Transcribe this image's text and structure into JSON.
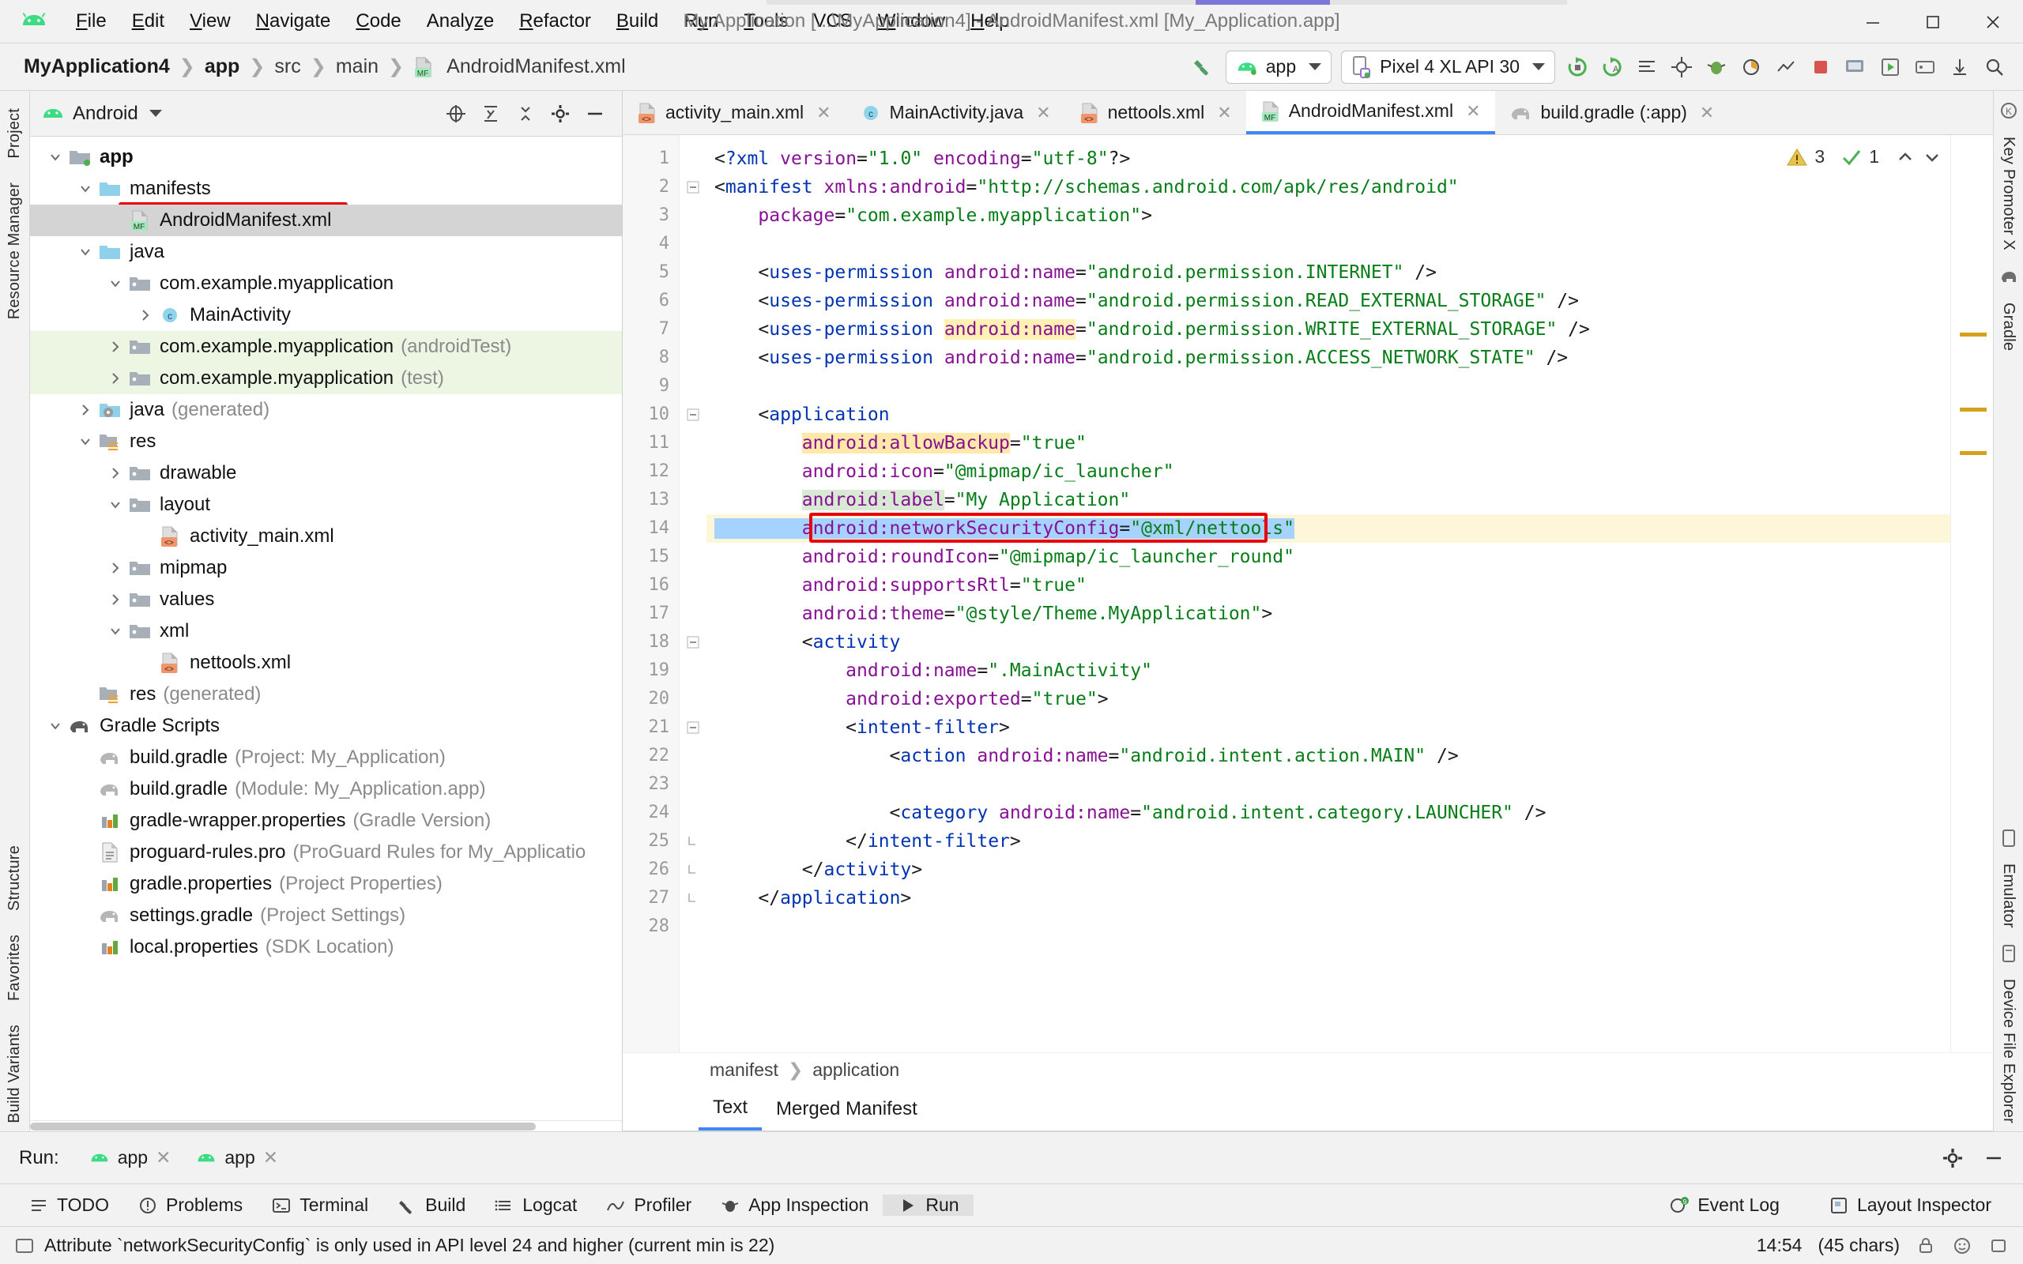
{
  "window": {
    "title": "My Application [...\\MyApplication4] - AndroidManifest.xml [My_Application.app]",
    "minimize": "—",
    "maximize": "▢",
    "close": "✕"
  },
  "menu": {
    "items": [
      {
        "label": "File",
        "accel": "F"
      },
      {
        "label": "Edit",
        "accel": "E"
      },
      {
        "label": "View",
        "accel": "V"
      },
      {
        "label": "Navigate",
        "accel": "N"
      },
      {
        "label": "Code",
        "accel": "C"
      },
      {
        "label": "Analyze",
        "accel": "z"
      },
      {
        "label": "Refactor",
        "accel": "R"
      },
      {
        "label": "Build",
        "accel": "B"
      },
      {
        "label": "Run",
        "accel": "u"
      },
      {
        "label": "Tools",
        "accel": "T"
      },
      {
        "label": "VCS",
        "accel": ""
      },
      {
        "label": "Window",
        "accel": "W"
      },
      {
        "label": "Help",
        "accel": "H"
      }
    ]
  },
  "breadcrumbs": {
    "items": [
      "MyApplication4",
      "app",
      "src",
      "main",
      "AndroidManifest.xml"
    ],
    "separator": "❯"
  },
  "toolbar": {
    "run_config": "app",
    "device": "Pixel 4 XL API 30"
  },
  "project_panel": {
    "title": "Android",
    "tree": [
      {
        "label": "app",
        "sub": "",
        "depth": 0,
        "twisty": "down",
        "icon": "module-folder-icon",
        "bold": true,
        "state": ""
      },
      {
        "label": "manifests",
        "sub": "",
        "depth": 1,
        "twisty": "down",
        "icon": "folder-blue-icon",
        "bold": false,
        "state": ""
      },
      {
        "label": "AndroidManifest.xml",
        "sub": "",
        "depth": 2,
        "twisty": "none",
        "icon": "manifest-file-icon",
        "bold": false,
        "state": "selected"
      },
      {
        "label": "java",
        "sub": "",
        "depth": 1,
        "twisty": "down",
        "icon": "folder-blue-icon",
        "bold": false,
        "state": ""
      },
      {
        "label": "com.example.myapplication",
        "sub": "",
        "depth": 2,
        "twisty": "down",
        "icon": "package-icon",
        "bold": false,
        "state": ""
      },
      {
        "label": "MainActivity",
        "sub": "",
        "depth": 3,
        "twisty": "right",
        "icon": "class-icon",
        "bold": false,
        "state": ""
      },
      {
        "label": "com.example.myapplication",
        "sub": "(androidTest)",
        "depth": 2,
        "twisty": "right",
        "icon": "package-icon",
        "bold": false,
        "state": "green"
      },
      {
        "label": "com.example.myapplication",
        "sub": "(test)",
        "depth": 2,
        "twisty": "right",
        "icon": "package-icon",
        "bold": false,
        "state": "green"
      },
      {
        "label": "java",
        "sub": "(generated)",
        "depth": 1,
        "twisty": "right",
        "icon": "folder-generated-icon",
        "bold": false,
        "state": ""
      },
      {
        "label": "res",
        "sub": "",
        "depth": 1,
        "twisty": "down",
        "icon": "res-folder-icon",
        "bold": false,
        "state": ""
      },
      {
        "label": "drawable",
        "sub": "",
        "depth": 2,
        "twisty": "right",
        "icon": "package-icon",
        "bold": false,
        "state": ""
      },
      {
        "label": "layout",
        "sub": "",
        "depth": 2,
        "twisty": "down",
        "icon": "package-icon",
        "bold": false,
        "state": ""
      },
      {
        "label": "activity_main.xml",
        "sub": "",
        "depth": 3,
        "twisty": "none",
        "icon": "xml-file-icon",
        "bold": false,
        "state": ""
      },
      {
        "label": "mipmap",
        "sub": "",
        "depth": 2,
        "twisty": "right",
        "icon": "package-icon",
        "bold": false,
        "state": ""
      },
      {
        "label": "values",
        "sub": "",
        "depth": 2,
        "twisty": "right",
        "icon": "package-icon",
        "bold": false,
        "state": ""
      },
      {
        "label": "xml",
        "sub": "",
        "depth": 2,
        "twisty": "down",
        "icon": "package-icon",
        "bold": false,
        "state": ""
      },
      {
        "label": "nettools.xml",
        "sub": "",
        "depth": 3,
        "twisty": "none",
        "icon": "xml-file-icon",
        "bold": false,
        "state": ""
      },
      {
        "label": "res",
        "sub": "(generated)",
        "depth": 1,
        "twisty": "none",
        "icon": "res-folder-icon",
        "bold": false,
        "state": ""
      },
      {
        "label": "Gradle Scripts",
        "sub": "",
        "depth": 0,
        "twisty": "down",
        "icon": "gradle-icon",
        "bold": false,
        "state": ""
      },
      {
        "label": "build.gradle",
        "sub": "(Project: My_Application)",
        "depth": 1,
        "twisty": "none",
        "icon": "gradle-file-icon",
        "bold": false,
        "state": ""
      },
      {
        "label": "build.gradle",
        "sub": "(Module: My_Application.app)",
        "depth": 1,
        "twisty": "none",
        "icon": "gradle-file-icon",
        "bold": false,
        "state": ""
      },
      {
        "label": "gradle-wrapper.properties",
        "sub": "(Gradle Version)",
        "depth": 1,
        "twisty": "none",
        "icon": "properties-icon",
        "bold": false,
        "state": ""
      },
      {
        "label": "proguard-rules.pro",
        "sub": "(ProGuard Rules for My_Applicatio",
        "depth": 1,
        "twisty": "none",
        "icon": "text-file-icon",
        "bold": false,
        "state": ""
      },
      {
        "label": "gradle.properties",
        "sub": "(Project Properties)",
        "depth": 1,
        "twisty": "none",
        "icon": "properties-icon",
        "bold": false,
        "state": ""
      },
      {
        "label": "settings.gradle",
        "sub": "(Project Settings)",
        "depth": 1,
        "twisty": "none",
        "icon": "gradle-file-icon",
        "bold": false,
        "state": ""
      },
      {
        "label": "local.properties",
        "sub": "(SDK Location)",
        "depth": 1,
        "twisty": "none",
        "icon": "properties-icon",
        "bold": false,
        "state": ""
      }
    ]
  },
  "editor": {
    "tabs": [
      {
        "label": "activity_main.xml",
        "icon": "xml-file-icon",
        "active": false
      },
      {
        "label": "MainActivity.java",
        "icon": "class-icon",
        "active": false
      },
      {
        "label": "nettools.xml",
        "icon": "xml-file-icon",
        "active": false
      },
      {
        "label": "AndroidManifest.xml",
        "icon": "manifest-file-icon",
        "active": true
      },
      {
        "label": "build.gradle (:app)",
        "icon": "gradle-file-icon",
        "active": false
      }
    ],
    "inspection": {
      "warnings": "3",
      "checks": "1"
    },
    "breadcrumb": {
      "items": [
        "manifest",
        "application"
      ],
      "separator": "❯"
    },
    "subtabs": [
      {
        "label": "Text",
        "active": true
      },
      {
        "label": "Merged Manifest",
        "active": false
      }
    ],
    "lines": [
      {
        "n": 1,
        "fold": "",
        "text": "<?xml version=\"1.0\" encoding=\"utf-8\"?>"
      },
      {
        "n": 2,
        "fold": "minus",
        "text": "<manifest xmlns:android=\"http://schemas.android.com/apk/res/android\""
      },
      {
        "n": 3,
        "fold": "",
        "text": "    package=\"com.example.myapplication\">"
      },
      {
        "n": 4,
        "fold": "",
        "text": ""
      },
      {
        "n": 5,
        "fold": "",
        "text": "    <uses-permission android:name=\"android.permission.INTERNET\" />"
      },
      {
        "n": 6,
        "fold": "",
        "text": "    <uses-permission android:name=\"android.permission.READ_EXTERNAL_STORAGE\" />"
      },
      {
        "n": 7,
        "fold": "",
        "text": "    <uses-permission android:name=\"android.permission.WRITE_EXTERNAL_STORAGE\" />"
      },
      {
        "n": 8,
        "fold": "",
        "text": "    <uses-permission android:name=\"android.permission.ACCESS_NETWORK_STATE\" />"
      },
      {
        "n": 9,
        "fold": "",
        "text": ""
      },
      {
        "n": 10,
        "fold": "minus",
        "text": "    <application"
      },
      {
        "n": 11,
        "fold": "",
        "text": "        android:allowBackup=\"true\""
      },
      {
        "n": 12,
        "fold": "",
        "text": "        android:icon=\"@mipmap/ic_launcher\""
      },
      {
        "n": 13,
        "fold": "",
        "text": "        android:label=\"My Application\""
      },
      {
        "n": 14,
        "fold": "",
        "text": "        android:networkSecurityConfig=\"@xml/nettools\""
      },
      {
        "n": 15,
        "fold": "",
        "text": "        android:roundIcon=\"@mipmap/ic_launcher_round\""
      },
      {
        "n": 16,
        "fold": "",
        "text": "        android:supportsRtl=\"true\""
      },
      {
        "n": 17,
        "fold": "",
        "text": "        android:theme=\"@style/Theme.MyApplication\">"
      },
      {
        "n": 18,
        "fold": "minus",
        "text": "        <activity"
      },
      {
        "n": 19,
        "fold": "",
        "text": "            android:name=\".MainActivity\""
      },
      {
        "n": 20,
        "fold": "",
        "text": "            android:exported=\"true\">"
      },
      {
        "n": 21,
        "fold": "minus",
        "text": "            <intent-filter>"
      },
      {
        "n": 22,
        "fold": "",
        "text": "                <action android:name=\"android.intent.action.MAIN\" />"
      },
      {
        "n": 23,
        "fold": "",
        "text": ""
      },
      {
        "n": 24,
        "fold": "",
        "text": "                <category android:name=\"android.intent.category.LAUNCHER\" />"
      },
      {
        "n": 25,
        "fold": "end",
        "text": "            </intent-filter>"
      },
      {
        "n": 26,
        "fold": "end",
        "text": "        </activity>"
      },
      {
        "n": 27,
        "fold": "end",
        "text": "    </application>"
      },
      {
        "n": 28,
        "fold": "",
        "text": ""
      }
    ]
  },
  "run_panel": {
    "label": "Run:",
    "tabs": [
      "app",
      "app"
    ]
  },
  "bottom_toolbar": {
    "left": [
      {
        "label": "TODO",
        "icon": "todo-icon",
        "active": false
      },
      {
        "label": "Problems",
        "icon": "problems-icon",
        "active": false
      },
      {
        "label": "Terminal",
        "icon": "terminal-icon",
        "active": false
      },
      {
        "label": "Build",
        "icon": "build-hammer-icon",
        "active": false
      },
      {
        "label": "Logcat",
        "icon": "logcat-icon",
        "active": false
      },
      {
        "label": "Profiler",
        "icon": "profiler-icon",
        "active": false
      },
      {
        "label": "App Inspection",
        "icon": "app-inspection-icon",
        "active": false
      },
      {
        "label": "Run",
        "icon": "run-play-icon",
        "active": true
      }
    ],
    "right": [
      {
        "label": "Event Log",
        "icon": "event-log-icon"
      },
      {
        "label": "Layout Inspector",
        "icon": "layout-inspector-icon"
      }
    ]
  },
  "status_bar": {
    "message": "Attribute `networkSecurityConfig` is only used in API level 24 and higher (current min is 22)",
    "position": "14:54",
    "chars": "(45 chars)"
  },
  "rails": {
    "left": [
      "Project",
      "Resource Manager",
      "Structure",
      "Favorites",
      "Build Variants"
    ],
    "right": [
      "Key Promoter X",
      "Gradle",
      "Emulator",
      "Device File Explorer"
    ]
  },
  "colors": {
    "accent_blue": "#4285f4",
    "android_green": "#3ddc84",
    "highlight_red": "#e8000d",
    "tag_blue": "#0033b3",
    "attr_purple": "#871094",
    "string_green": "#067d17",
    "warn_yellow": "#fdf6d8",
    "selection_blue": "#a6d2ff"
  }
}
